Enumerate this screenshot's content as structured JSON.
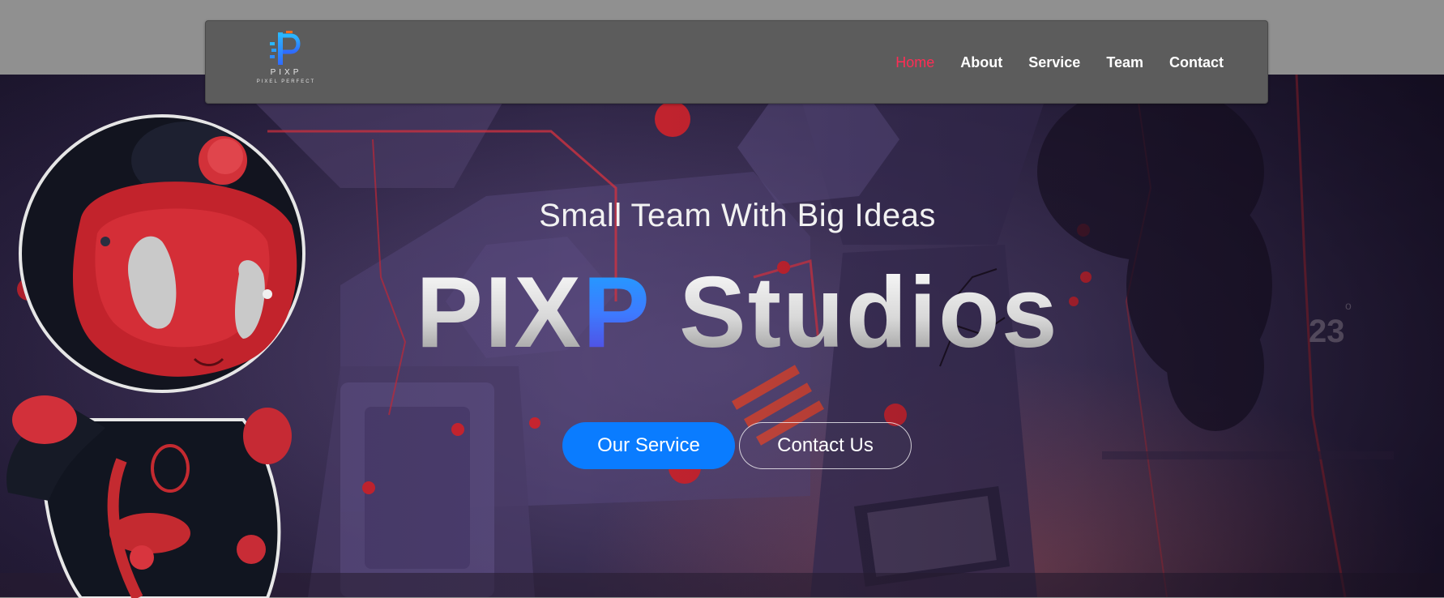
{
  "brand": {
    "logo_letter": "P",
    "logo_name": "PIXP",
    "logo_tagline": "PIXEL PERFECT"
  },
  "nav": {
    "items": [
      {
        "label": "Home",
        "active": true
      },
      {
        "label": "About",
        "active": false
      },
      {
        "label": "Service",
        "active": false
      },
      {
        "label": "Team",
        "active": false
      },
      {
        "label": "Contact",
        "active": false
      }
    ]
  },
  "hero": {
    "tagline": "Small Team With Big Ideas",
    "title_part1": "PIX",
    "title_part2": "P",
    "title_part3": " Studios",
    "primary_button": "Our Service",
    "secondary_button": "Contact Us"
  },
  "colors": {
    "accent_active": "#ff2d55",
    "primary_button": "#0a7cff",
    "navbar_bg": "#5c5c5c"
  }
}
